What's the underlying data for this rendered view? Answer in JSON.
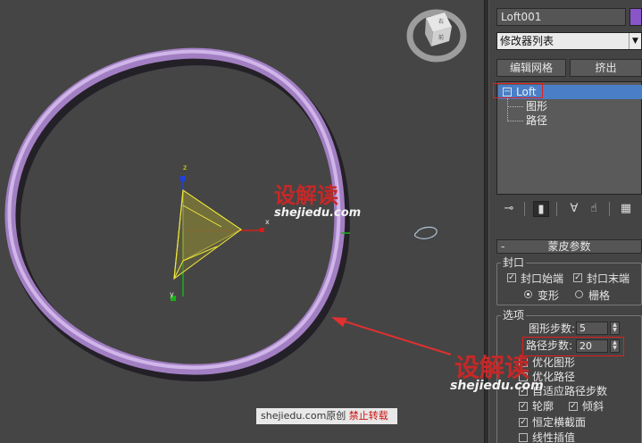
{
  "viewport": {
    "caption": {
      "site": "shejiedu.com",
      "mid": "原创",
      "warning": "禁止转载"
    },
    "axes": {
      "z": "z",
      "x": "x",
      "y": "y"
    },
    "viewcube_faces": [
      "右",
      "前"
    ],
    "colors": {
      "loft_ring": "#c8a2e6",
      "pyramid": "#e8e21a",
      "axis_x": "#d02020",
      "axis_y": "#18b018",
      "axis_z": "#2040e0",
      "arrow": "#e03030"
    }
  },
  "watermark": {
    "cn": "设解读",
    "en": "shejiedu.com"
  },
  "panel": {
    "object_name": "Loft001",
    "object_color": "#8a55c8",
    "modifier_list": "修改器列表",
    "buttons": {
      "edit_mesh": "编辑网格",
      "extrude": "挤出"
    },
    "stack": {
      "root": "Loft",
      "children": [
        "图形",
        "路径"
      ]
    },
    "rollout_title": "蒙皮参数",
    "cap_group": {
      "label": "封口",
      "cap_start": "封口始端",
      "cap_end": "封口末端",
      "morph": "变形",
      "grid": "栅格"
    },
    "options_group": {
      "label": "选项",
      "shape_steps_label": "图形步数:",
      "shape_steps_value": "5",
      "path_steps_label": "路径步数:",
      "path_steps_value": "20",
      "optimize_shapes": "优化图形",
      "optimize_path": "优化路径",
      "adaptive_path_steps": "自适应路径步数",
      "contour": "轮廓",
      "banking": "倾斜",
      "constant_cross_section": "恒定横截面",
      "linear_interpolation": "线性插值"
    }
  }
}
